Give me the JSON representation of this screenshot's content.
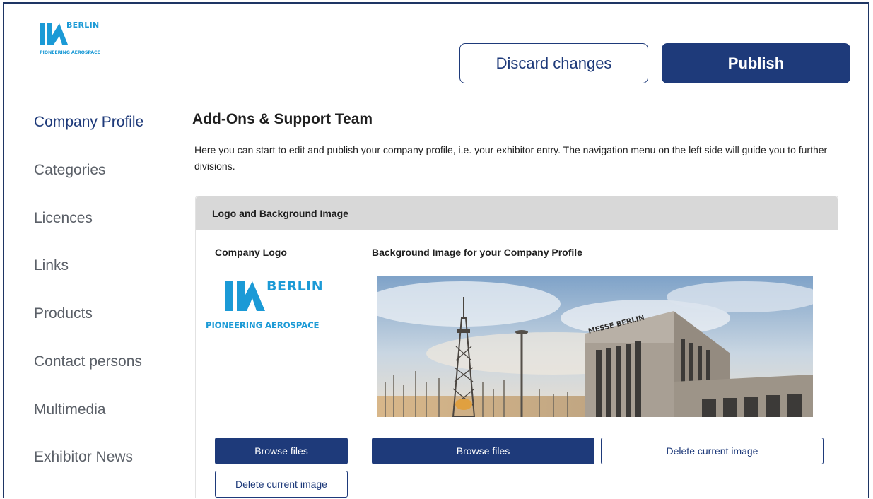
{
  "brand": {
    "logo_berlin": "BERLIN",
    "logo_tagline": "PIONEERING AEROSPACE",
    "color": "#1b9ad6"
  },
  "toolbar": {
    "discard_label": "Discard changes",
    "publish_label": "Publish"
  },
  "sidebar": {
    "items": [
      {
        "label": "Company Profile",
        "active": true
      },
      {
        "label": "Categories"
      },
      {
        "label": "Licences"
      },
      {
        "label": "Links"
      },
      {
        "label": "Products"
      },
      {
        "label": "Contact persons"
      },
      {
        "label": "Multimedia"
      },
      {
        "label": "Exhibitor News"
      }
    ]
  },
  "main": {
    "title": "Add-Ons & Support Team",
    "intro": "Here you can start to edit and publish your company profile, i.e. your exhibitor entry. The navigation menu on the left side will guide you to further divisions.",
    "panel": {
      "heading": "Logo and Background Image",
      "logo_label": "Company Logo",
      "bg_label": "Background Image for your Company Profile",
      "bg_sign_text": "MESSE BERLIN",
      "browse_label": "Browse files",
      "delete_label": "Delete current image"
    }
  },
  "colors": {
    "accent": "#1e3a7a",
    "panel_header": "#d8d8d8",
    "sidebar_text": "#5b6068"
  }
}
